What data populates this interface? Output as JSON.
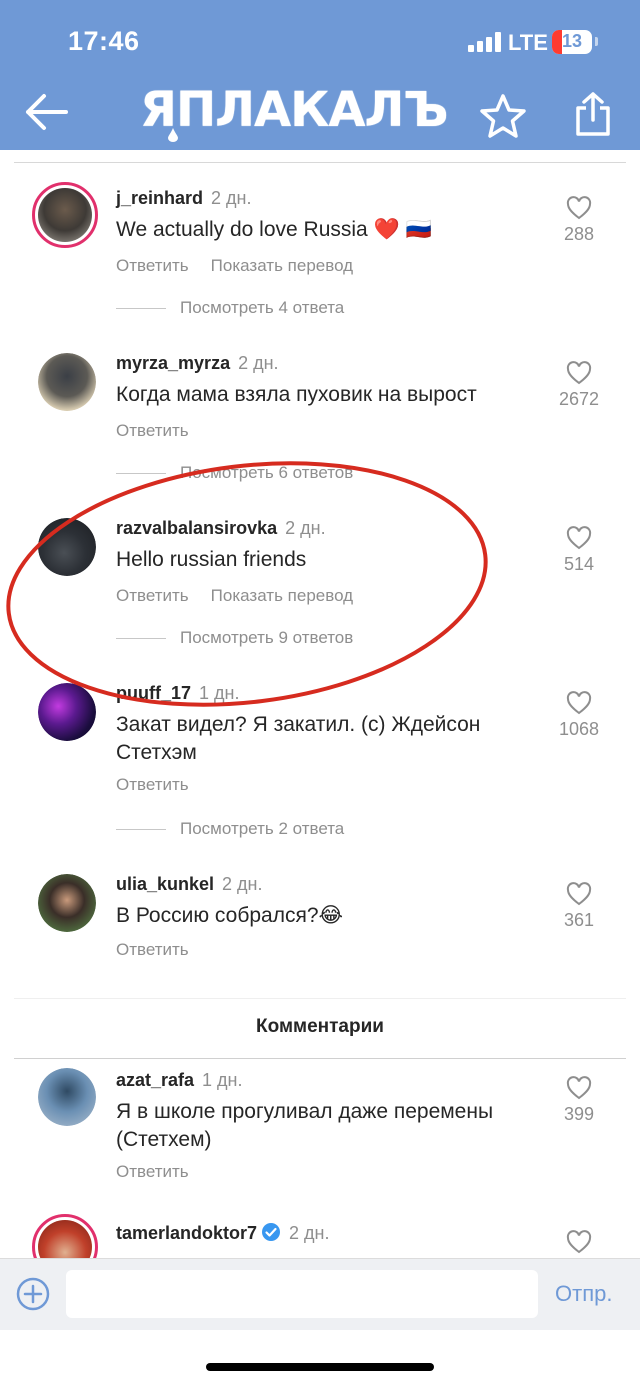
{
  "status_bar": {
    "time": "17:46",
    "network": "LTE",
    "battery": "13"
  },
  "header": {
    "logo_text": "ЯПЛАКАЛЪ",
    "back_icon": "arrow-left-icon",
    "star_icon": "star-icon",
    "share_icon": "share-icon",
    "bar_color": "#6f99d6"
  },
  "comments": [
    {
      "username": "j_reinhard",
      "time": "2 дн.",
      "text": "We actually do love Russia ❤️ 🇷🇺",
      "likes": "288",
      "actions": [
        "Ответить",
        "Показать перевод"
      ],
      "replies": "Посмотреть 4 ответа"
    },
    {
      "username": "myrza_myrza",
      "time": "2 дн.",
      "text": "Когда мама взяла пуховик на вырост",
      "likes": "2672",
      "actions": [
        "Ответить"
      ],
      "replies": "Посмотреть 6 ответов"
    },
    {
      "username": "razvalbalansirovka",
      "time": "2 дн.",
      "text": "Hello russian friends",
      "likes": "514",
      "actions": [
        "Ответить",
        "Показать перевод"
      ],
      "replies": "Посмотреть 9 ответов"
    },
    {
      "username": "puuff_17",
      "time": "1 дн.",
      "text": "Закат видел? Я закатил. (с) Ждейсон Стетхэм",
      "likes": "1068",
      "actions": [
        "Ответить"
      ],
      "replies": "Посмотреть 2 ответа"
    },
    {
      "username": "ulia_kunkel",
      "time": "2 дн.",
      "text": "В Россию собрался?😂",
      "likes": "361",
      "actions": [
        "Ответить"
      ]
    }
  ],
  "section_title": "Комментарии",
  "comments2": [
    {
      "username": "azat_rafa",
      "time": "1 дн.",
      "text": "Я в школе прогуливал даже перемены (Стетхем)",
      "likes": "399",
      "actions": [
        "Ответить"
      ]
    },
    {
      "username": "tamerlandoktor7",
      "time": "2 дн.",
      "verified": true
    }
  ],
  "input": {
    "placeholder": "",
    "send_label": "Отпр.",
    "plus_icon": "plus-circle-icon"
  },
  "annotation": {
    "shape": "ellipse",
    "color": "#d62b1f"
  }
}
